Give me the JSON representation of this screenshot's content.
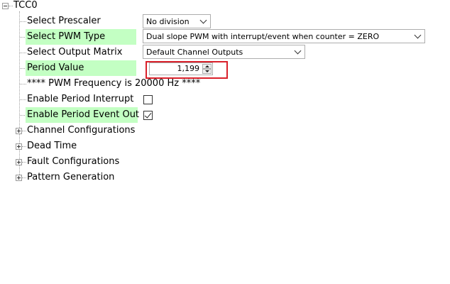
{
  "tree": {
    "root_label": "TCC0",
    "rows": {
      "prescaler": {
        "label": "Select Prescaler",
        "value": "No division"
      },
      "pwm_type": {
        "label": "Select PWM Type",
        "value": "Dual slope PWM with interrupt/event when counter = ZERO"
      },
      "output_matrix": {
        "label": "Select Output Matrix",
        "value": "Default Channel Outputs"
      },
      "period_value": {
        "label": "Period Value",
        "value": "1,199"
      },
      "pwm_frequency": {
        "text": "**** PWM Frequency is 20000 Hz ****"
      },
      "period_interrupt": {
        "label": "Enable Period Interrupt",
        "checked": false
      },
      "period_event_out": {
        "label": "Enable Period Event Out",
        "checked": true
      }
    },
    "groups": [
      {
        "label": "Channel Configurations"
      },
      {
        "label": "Dead Time"
      },
      {
        "label": "Fault Configurations"
      },
      {
        "label": "Pattern Generation"
      }
    ]
  },
  "colors": {
    "highlight": "#c3ffc3",
    "focus_box": "#d9202a"
  }
}
